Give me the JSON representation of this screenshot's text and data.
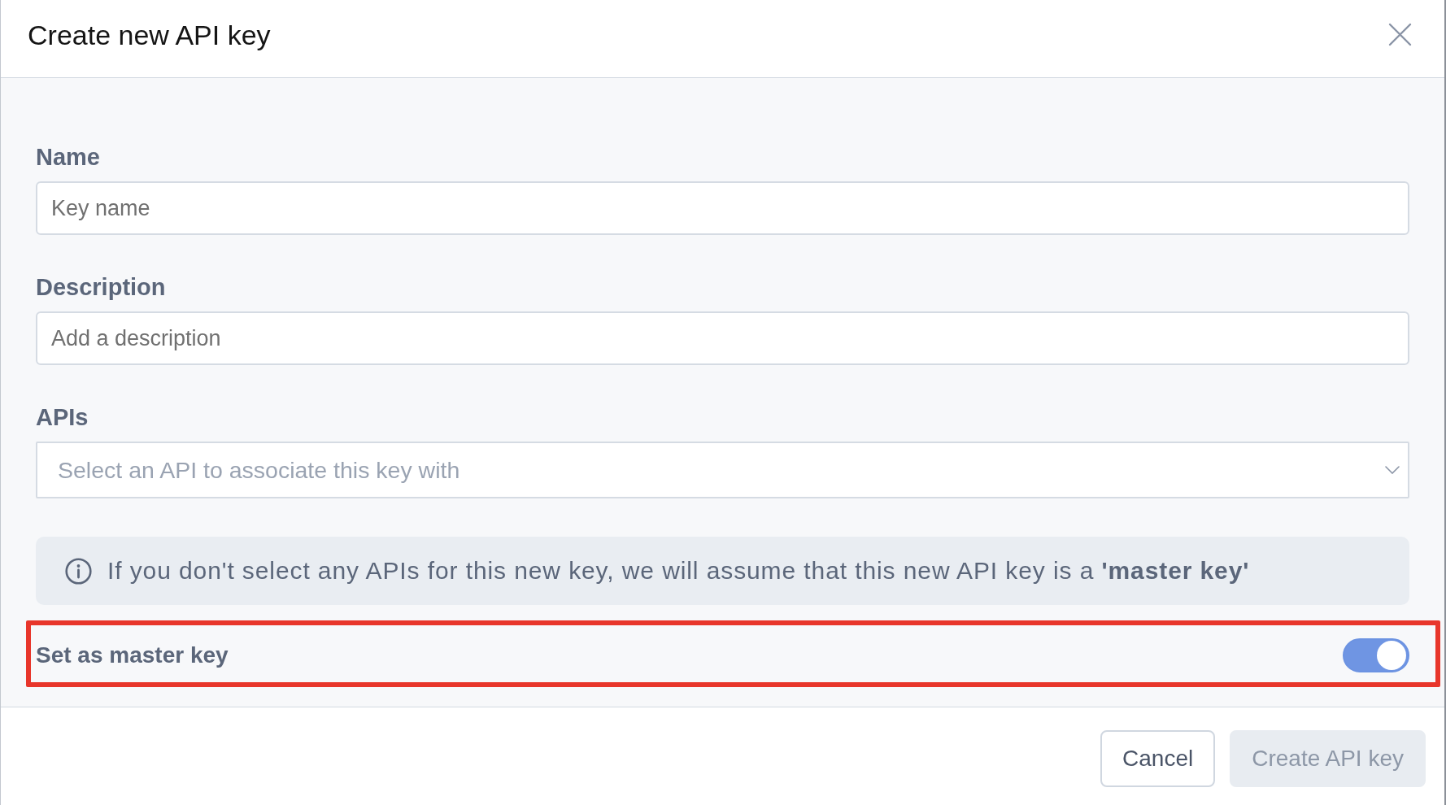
{
  "dialog": {
    "title": "Create new API key"
  },
  "fields": [
    {
      "kind": "text",
      "label": "Name",
      "placeholder": "Key name"
    },
    {
      "kind": "text",
      "label": "Description",
      "placeholder": "Add a description"
    },
    {
      "kind": "select",
      "label": "APIs",
      "placeholder": "Select an API to associate this key with"
    }
  ],
  "notice": {
    "text": "If you don't select any APIs for this new key, we will assume that this new API key is a **'master key'**"
  },
  "master_key": {
    "label": "Set as master key",
    "on": true,
    "highlighted": true
  },
  "buttons": [
    {
      "label": "Cancel",
      "kind": "secondary",
      "disabled": false
    },
    {
      "label": "Create API key",
      "kind": "primary",
      "disabled": true
    }
  ]
}
